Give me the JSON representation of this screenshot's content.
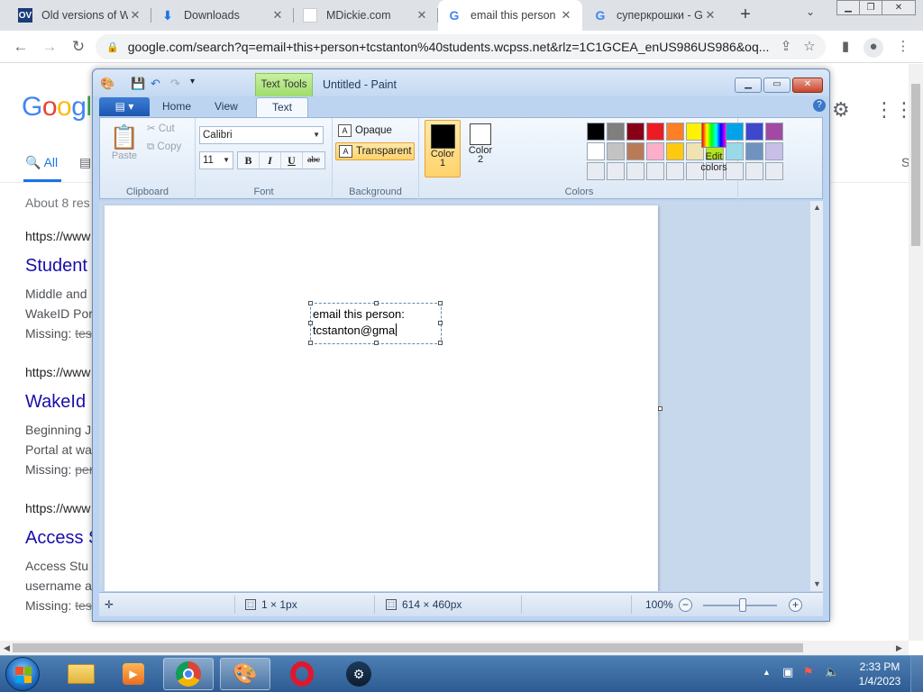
{
  "browser": {
    "tabs": [
      {
        "label": "Old versions of W",
        "favicon": "OV"
      },
      {
        "label": "Downloads",
        "favicon": "download-icon"
      },
      {
        "label": "MDickie.com",
        "favicon": "blank-page-icon"
      },
      {
        "label": "email this person",
        "favicon": "google-g-icon"
      },
      {
        "label": "суперкрошки - G",
        "favicon": "google-g-icon"
      }
    ],
    "url": "google.com/search?q=email+this+person+tcstanton%40students.wcpss.net&rlz=1C1GCEA_enUS986US986&oq..."
  },
  "google": {
    "logo": "Googl",
    "tab_all": "All",
    "tab_right": "S",
    "stats": "About 8 res",
    "results": [
      {
        "cite": "https://www",
        "title": "Student",
        "snippet_1": "Middle and",
        "snippet_2": "WakeID Por",
        "missing_label": "Missing:",
        "missing_term": "tes"
      },
      {
        "cite": "https://www",
        "title": "WakeId",
        "snippet_1": "Beginning J",
        "snippet_2": "Portal at wa",
        "missing_label": "Missing:",
        "missing_term": "per"
      },
      {
        "cite": "https://www",
        "title": "Access S",
        "snippet_1": "Access Stu",
        "snippet_2": "username a",
        "missing_label": "Missing:",
        "missing_term": "tes"
      }
    ]
  },
  "paint": {
    "title": "Untitled - Paint",
    "context_tab": "Text Tools",
    "file_menu": "file-menu-icon",
    "tabs": {
      "home": "Home",
      "view": "View",
      "text": "Text"
    },
    "clipboard": {
      "paste": "Paste",
      "cut": "Cut",
      "copy": "Copy",
      "group": "Clipboard"
    },
    "font": {
      "family": "Calibri",
      "size": "11",
      "bold": "B",
      "italic": "I",
      "underline": "U",
      "strike": "abc",
      "group": "Font"
    },
    "background": {
      "opaque": "Opaque",
      "transparent": "Transparent",
      "group": "Background"
    },
    "colors": {
      "color1_label": "Color",
      "color1_num": "1",
      "color2_label": "Color",
      "color2_num": "2",
      "edit_label": "Edit",
      "edit_label2": "colors",
      "group": "Colors",
      "color1": "#000000",
      "color2": "#ffffff",
      "palette": [
        "#000000",
        "#7f7f7f",
        "#880015",
        "#ed1c24",
        "#ff7f27",
        "#fff200",
        "#22b14c",
        "#00a2e8",
        "#3f48cc",
        "#a349a4",
        "#ffffff",
        "#c3c3c3",
        "#b97a57",
        "#ffaec9",
        "#ffc90e",
        "#efe4b0",
        "#b5e61d",
        "#99d9ea",
        "#7092be",
        "#c8bfe7",
        "#e8ecf2",
        "#e8ecf2",
        "#e8ecf2",
        "#e8ecf2",
        "#e8ecf2",
        "#e8ecf2",
        "#e8ecf2",
        "#e8ecf2",
        "#e8ecf2",
        "#e8ecf2"
      ]
    },
    "canvas_text_line1": "email this person:",
    "canvas_text_line2": "tcstanton@gma",
    "status": {
      "selection": "1 × 1px",
      "size": "614 × 460px",
      "zoom": "100%"
    }
  },
  "taskbar": {
    "apps": [
      "file-explorer-icon",
      "media-player-icon",
      "chrome-icon",
      "paint-icon",
      "opera-icon",
      "steam-icon"
    ],
    "time": "2:33 PM",
    "date": "1/4/2023"
  }
}
